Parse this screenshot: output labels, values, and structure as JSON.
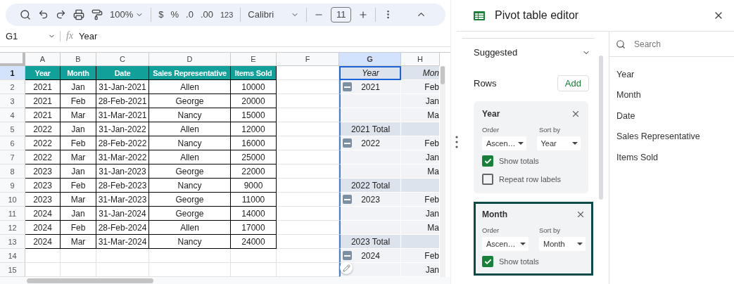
{
  "toolbar": {
    "zoom": "100%",
    "currency": "$",
    "percent": "%",
    "decimal_less": ".0",
    "decimal_more": ".00",
    "number_format": "123",
    "font": "Calibri",
    "font_size": "11"
  },
  "formula_bar": {
    "cell": "G1",
    "fx": "fx",
    "value": "Year"
  },
  "columns": [
    {
      "label": "A",
      "selected": false
    },
    {
      "label": "B",
      "selected": false
    },
    {
      "label": "C",
      "selected": false
    },
    {
      "label": "D",
      "selected": false
    },
    {
      "label": "E",
      "selected": false
    },
    {
      "label": "F",
      "selected": false
    },
    {
      "label": "G",
      "selected": true
    },
    {
      "label": "H",
      "selected": false
    }
  ],
  "row_numbers": [
    {
      "label": "1",
      "selected": true
    },
    {
      "label": "2",
      "selected": false
    },
    {
      "label": "3",
      "selected": false
    },
    {
      "label": "4",
      "selected": false
    },
    {
      "label": "5",
      "selected": false
    },
    {
      "label": "6",
      "selected": false
    },
    {
      "label": "7",
      "selected": false
    },
    {
      "label": "8",
      "selected": false
    },
    {
      "label": "9",
      "selected": false
    },
    {
      "label": "10",
      "selected": false
    },
    {
      "label": "11",
      "selected": false
    },
    {
      "label": "12",
      "selected": false
    },
    {
      "label": "13",
      "selected": false
    },
    {
      "label": "14",
      "selected": false
    },
    {
      "label": "15",
      "selected": false
    }
  ],
  "table": {
    "columns": [
      "Year",
      "Month",
      "Date",
      "Sales Representative",
      "Items Sold"
    ],
    "rows": [
      [
        "2021",
        "Jan",
        "31-Jan-2021",
        "Allen",
        "10000"
      ],
      [
        "2021",
        "Feb",
        "28-Feb-2021",
        "George",
        "20000"
      ],
      [
        "2021",
        "Mar",
        "31-Mar-2021",
        "Nancy",
        "15000"
      ],
      [
        "2022",
        "Jan",
        "31-Jan-2022",
        "Allen",
        "12000"
      ],
      [
        "2022",
        "Feb",
        "28-Feb-2022",
        "Nancy",
        "16000"
      ],
      [
        "2022",
        "Mar",
        "31-Mar-2022",
        "Allen",
        "25000"
      ],
      [
        "2023",
        "Jan",
        "31-Jan-2023",
        "George",
        "22000"
      ],
      [
        "2023",
        "Feb",
        "28-Feb-2023",
        "Nancy",
        "9000"
      ],
      [
        "2023",
        "Mar",
        "31-Mar-2023",
        "George",
        "11000"
      ],
      [
        "2024",
        "Jan",
        "31-Jan-2024",
        "George",
        "14000"
      ],
      [
        "2024",
        "Feb",
        "28-Feb-2024",
        "Allen",
        "17000"
      ],
      [
        "2024",
        "Mar",
        "31-Mar-2024",
        "Nancy",
        "24000"
      ]
    ]
  },
  "pivot": [
    {
      "kind": "header",
      "g": "Year",
      "h": "Mon"
    },
    {
      "kind": "group",
      "g": "2021",
      "h": "Feb"
    },
    {
      "kind": "blank",
      "h": "Jan"
    },
    {
      "kind": "blank",
      "h": "Ma"
    },
    {
      "kind": "total",
      "g": "2021 Total"
    },
    {
      "kind": "group",
      "g": "2022",
      "h": "Feb"
    },
    {
      "kind": "blank",
      "h": "Jan"
    },
    {
      "kind": "blank",
      "h": "Ma"
    },
    {
      "kind": "total",
      "g": "2022 Total"
    },
    {
      "kind": "group",
      "g": "2023",
      "h": "Feb"
    },
    {
      "kind": "blank",
      "h": "Jan"
    },
    {
      "kind": "blank",
      "h": "Ma"
    },
    {
      "kind": "total",
      "g": "2023 Total"
    },
    {
      "kind": "group",
      "g": "2024",
      "h": "Feb"
    },
    {
      "kind": "blank",
      "h": "Jan"
    }
  ],
  "editor": {
    "title": "Pivot table editor",
    "suggested": "Suggested",
    "rows_label": "Rows",
    "add": "Add",
    "cards": [
      {
        "title": "Year",
        "selected": false,
        "order_label": "Order",
        "order": "Ascen…",
        "sort_label": "Sort by",
        "sort": "Year",
        "checks": [
          {
            "label": "Show totals",
            "checked": true
          },
          {
            "label": "Repeat row labels",
            "checked": false
          }
        ]
      },
      {
        "title": "Month",
        "selected": true,
        "order_label": "Order",
        "order": "Ascen…",
        "sort_label": "Sort by",
        "sort": "Month",
        "checks": [
          {
            "label": "Show totals",
            "checked": true
          }
        ]
      }
    ],
    "search_placeholder": "Search",
    "fields": [
      "Year",
      "Month",
      "Date",
      "Sales Representative",
      "Items Sold"
    ]
  }
}
